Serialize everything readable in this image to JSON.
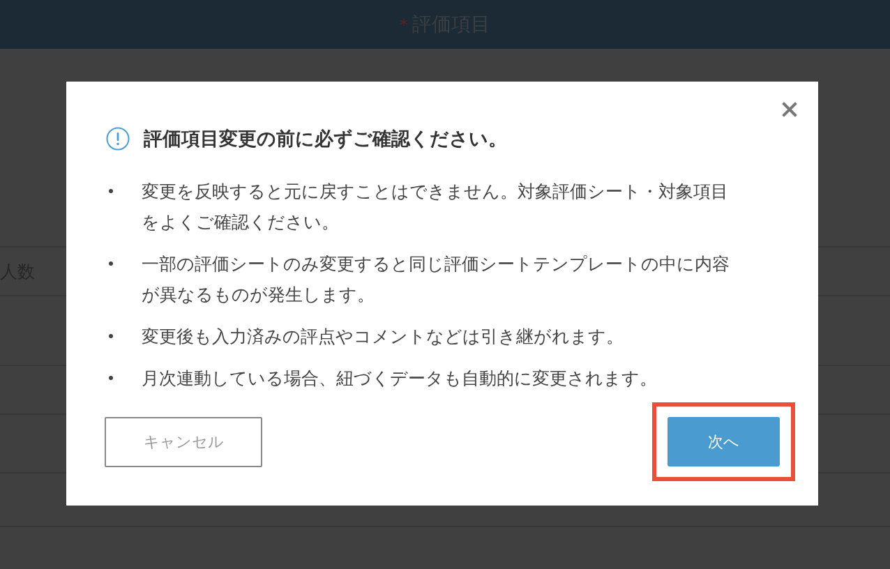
{
  "header": {
    "required_mark": "*",
    "title": "評価項目"
  },
  "background_table": {
    "visible_cell": "人数"
  },
  "dialog": {
    "title": "評価項目変更の前に必ずご確認ください。",
    "items": [
      {
        "lines": [
          "変更を反映すると元に戻すことはできません。対象評価シート・対象項目",
          "をよくご確認ください。"
        ]
      },
      {
        "lines": [
          "一部の評価シートのみ変更すると同じ評価シートテンプレートの中に内容",
          "が異なるものが発生します。"
        ]
      },
      {
        "lines": [
          "変更後も入力済みの評点やコメントなどは引き継がれます。"
        ]
      },
      {
        "lines": [
          "月次連動している場合、紐づくデータも自動的に変更されます。"
        ]
      }
    ],
    "cancel_button": "キャンセル",
    "next_button": {
      "label": "次へ",
      "highlighted": true
    }
  }
}
